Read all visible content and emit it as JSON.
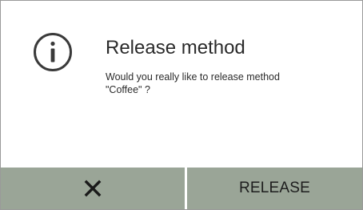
{
  "dialog": {
    "title": "Release method",
    "message_line1": "Would you really like to release method",
    "message_line2": "\"Coffee\" ?",
    "icon": "info-icon"
  },
  "buttons": {
    "cancel_icon": "close-icon",
    "release_label": "RELEASE"
  },
  "colors": {
    "button_background": "#9aa597",
    "text": "#2b2b2b",
    "border": "#9a9a9a"
  }
}
